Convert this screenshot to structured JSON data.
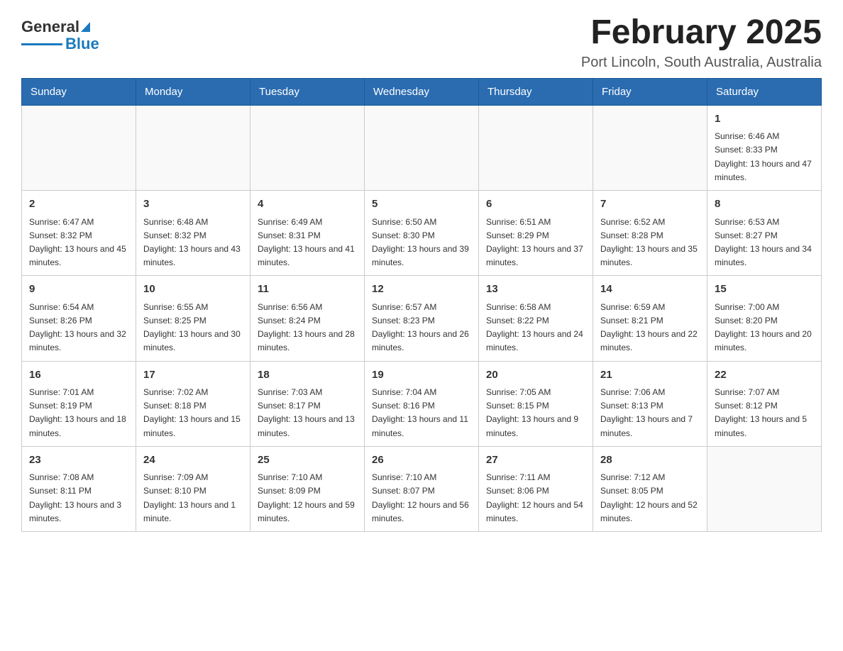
{
  "header": {
    "logo_general": "General",
    "logo_blue": "Blue",
    "main_title": "February 2025",
    "subtitle": "Port Lincoln, South Australia, Australia"
  },
  "days_of_week": [
    "Sunday",
    "Monday",
    "Tuesday",
    "Wednesday",
    "Thursday",
    "Friday",
    "Saturday"
  ],
  "weeks": [
    [
      {
        "day": "",
        "info": ""
      },
      {
        "day": "",
        "info": ""
      },
      {
        "day": "",
        "info": ""
      },
      {
        "day": "",
        "info": ""
      },
      {
        "day": "",
        "info": ""
      },
      {
        "day": "",
        "info": ""
      },
      {
        "day": "1",
        "info": "Sunrise: 6:46 AM\nSunset: 8:33 PM\nDaylight: 13 hours and 47 minutes."
      }
    ],
    [
      {
        "day": "2",
        "info": "Sunrise: 6:47 AM\nSunset: 8:32 PM\nDaylight: 13 hours and 45 minutes."
      },
      {
        "day": "3",
        "info": "Sunrise: 6:48 AM\nSunset: 8:32 PM\nDaylight: 13 hours and 43 minutes."
      },
      {
        "day": "4",
        "info": "Sunrise: 6:49 AM\nSunset: 8:31 PM\nDaylight: 13 hours and 41 minutes."
      },
      {
        "day": "5",
        "info": "Sunrise: 6:50 AM\nSunset: 8:30 PM\nDaylight: 13 hours and 39 minutes."
      },
      {
        "day": "6",
        "info": "Sunrise: 6:51 AM\nSunset: 8:29 PM\nDaylight: 13 hours and 37 minutes."
      },
      {
        "day": "7",
        "info": "Sunrise: 6:52 AM\nSunset: 8:28 PM\nDaylight: 13 hours and 35 minutes."
      },
      {
        "day": "8",
        "info": "Sunrise: 6:53 AM\nSunset: 8:27 PM\nDaylight: 13 hours and 34 minutes."
      }
    ],
    [
      {
        "day": "9",
        "info": "Sunrise: 6:54 AM\nSunset: 8:26 PM\nDaylight: 13 hours and 32 minutes."
      },
      {
        "day": "10",
        "info": "Sunrise: 6:55 AM\nSunset: 8:25 PM\nDaylight: 13 hours and 30 minutes."
      },
      {
        "day": "11",
        "info": "Sunrise: 6:56 AM\nSunset: 8:24 PM\nDaylight: 13 hours and 28 minutes."
      },
      {
        "day": "12",
        "info": "Sunrise: 6:57 AM\nSunset: 8:23 PM\nDaylight: 13 hours and 26 minutes."
      },
      {
        "day": "13",
        "info": "Sunrise: 6:58 AM\nSunset: 8:22 PM\nDaylight: 13 hours and 24 minutes."
      },
      {
        "day": "14",
        "info": "Sunrise: 6:59 AM\nSunset: 8:21 PM\nDaylight: 13 hours and 22 minutes."
      },
      {
        "day": "15",
        "info": "Sunrise: 7:00 AM\nSunset: 8:20 PM\nDaylight: 13 hours and 20 minutes."
      }
    ],
    [
      {
        "day": "16",
        "info": "Sunrise: 7:01 AM\nSunset: 8:19 PM\nDaylight: 13 hours and 18 minutes."
      },
      {
        "day": "17",
        "info": "Sunrise: 7:02 AM\nSunset: 8:18 PM\nDaylight: 13 hours and 15 minutes."
      },
      {
        "day": "18",
        "info": "Sunrise: 7:03 AM\nSunset: 8:17 PM\nDaylight: 13 hours and 13 minutes."
      },
      {
        "day": "19",
        "info": "Sunrise: 7:04 AM\nSunset: 8:16 PM\nDaylight: 13 hours and 11 minutes."
      },
      {
        "day": "20",
        "info": "Sunrise: 7:05 AM\nSunset: 8:15 PM\nDaylight: 13 hours and 9 minutes."
      },
      {
        "day": "21",
        "info": "Sunrise: 7:06 AM\nSunset: 8:13 PM\nDaylight: 13 hours and 7 minutes."
      },
      {
        "day": "22",
        "info": "Sunrise: 7:07 AM\nSunset: 8:12 PM\nDaylight: 13 hours and 5 minutes."
      }
    ],
    [
      {
        "day": "23",
        "info": "Sunrise: 7:08 AM\nSunset: 8:11 PM\nDaylight: 13 hours and 3 minutes."
      },
      {
        "day": "24",
        "info": "Sunrise: 7:09 AM\nSunset: 8:10 PM\nDaylight: 13 hours and 1 minute."
      },
      {
        "day": "25",
        "info": "Sunrise: 7:10 AM\nSunset: 8:09 PM\nDaylight: 12 hours and 59 minutes."
      },
      {
        "day": "26",
        "info": "Sunrise: 7:10 AM\nSunset: 8:07 PM\nDaylight: 12 hours and 56 minutes."
      },
      {
        "day": "27",
        "info": "Sunrise: 7:11 AM\nSunset: 8:06 PM\nDaylight: 12 hours and 54 minutes."
      },
      {
        "day": "28",
        "info": "Sunrise: 7:12 AM\nSunset: 8:05 PM\nDaylight: 12 hours and 52 minutes."
      },
      {
        "day": "",
        "info": ""
      }
    ]
  ]
}
